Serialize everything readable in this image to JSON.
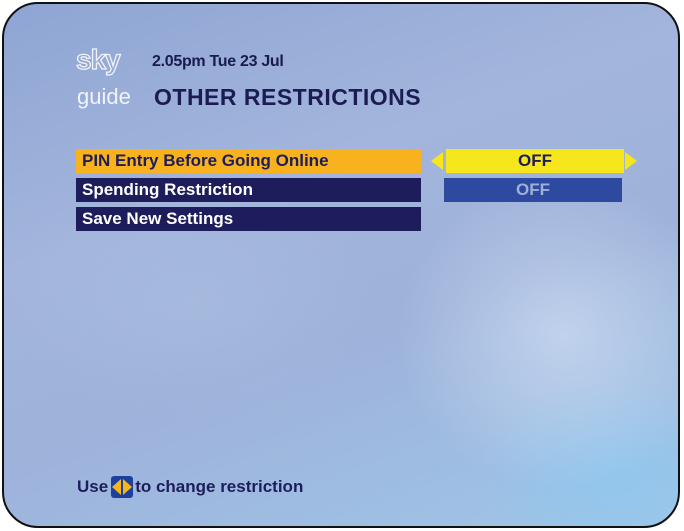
{
  "header": {
    "logo_sky": "sky",
    "logo_guide": "guide",
    "datetime": "2.05pm Tue 23 Jul",
    "title": "OTHER RESTRICTIONS"
  },
  "menu": {
    "items": [
      {
        "label": "PIN Entry Before Going Online",
        "value": "OFF",
        "selected": true
      },
      {
        "label": "Spending Restriction",
        "value": "OFF",
        "selected": false
      },
      {
        "label": "Save New Settings"
      }
    ]
  },
  "footer": {
    "hint_prefix": "Use",
    "hint_suffix": "to change restriction",
    "icon": "left-right-arrows-icon"
  },
  "colors": {
    "selected_row": "#f7b21d",
    "row": "#1d1d5c",
    "active_value": "#f6e61c",
    "inactive_value": "#2d4aa0"
  }
}
